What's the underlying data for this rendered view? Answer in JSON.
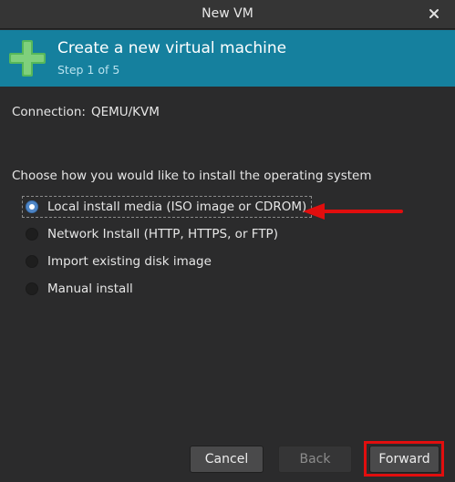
{
  "window": {
    "title": "New VM"
  },
  "banner": {
    "heading": "Create a new virtual machine",
    "step": "Step 1 of 5"
  },
  "connection": {
    "label": "Connection:",
    "value": "QEMU/KVM"
  },
  "install": {
    "prompt": "Choose how you would like to install the operating system",
    "options": [
      {
        "label": "Local install media (ISO image or CDROM)",
        "selected": true
      },
      {
        "label": "Network Install (HTTP, HTTPS, or FTP)",
        "selected": false
      },
      {
        "label": "Import existing disk image",
        "selected": false
      },
      {
        "label": "Manual install",
        "selected": false
      }
    ]
  },
  "buttons": {
    "cancel": "Cancel",
    "back": "Back",
    "forward": "Forward"
  },
  "colors": {
    "banner": "#15809e",
    "annotation": "#e10e0e"
  },
  "icons": {
    "close": "close-icon",
    "banner": "add-vm-plus-icon"
  }
}
